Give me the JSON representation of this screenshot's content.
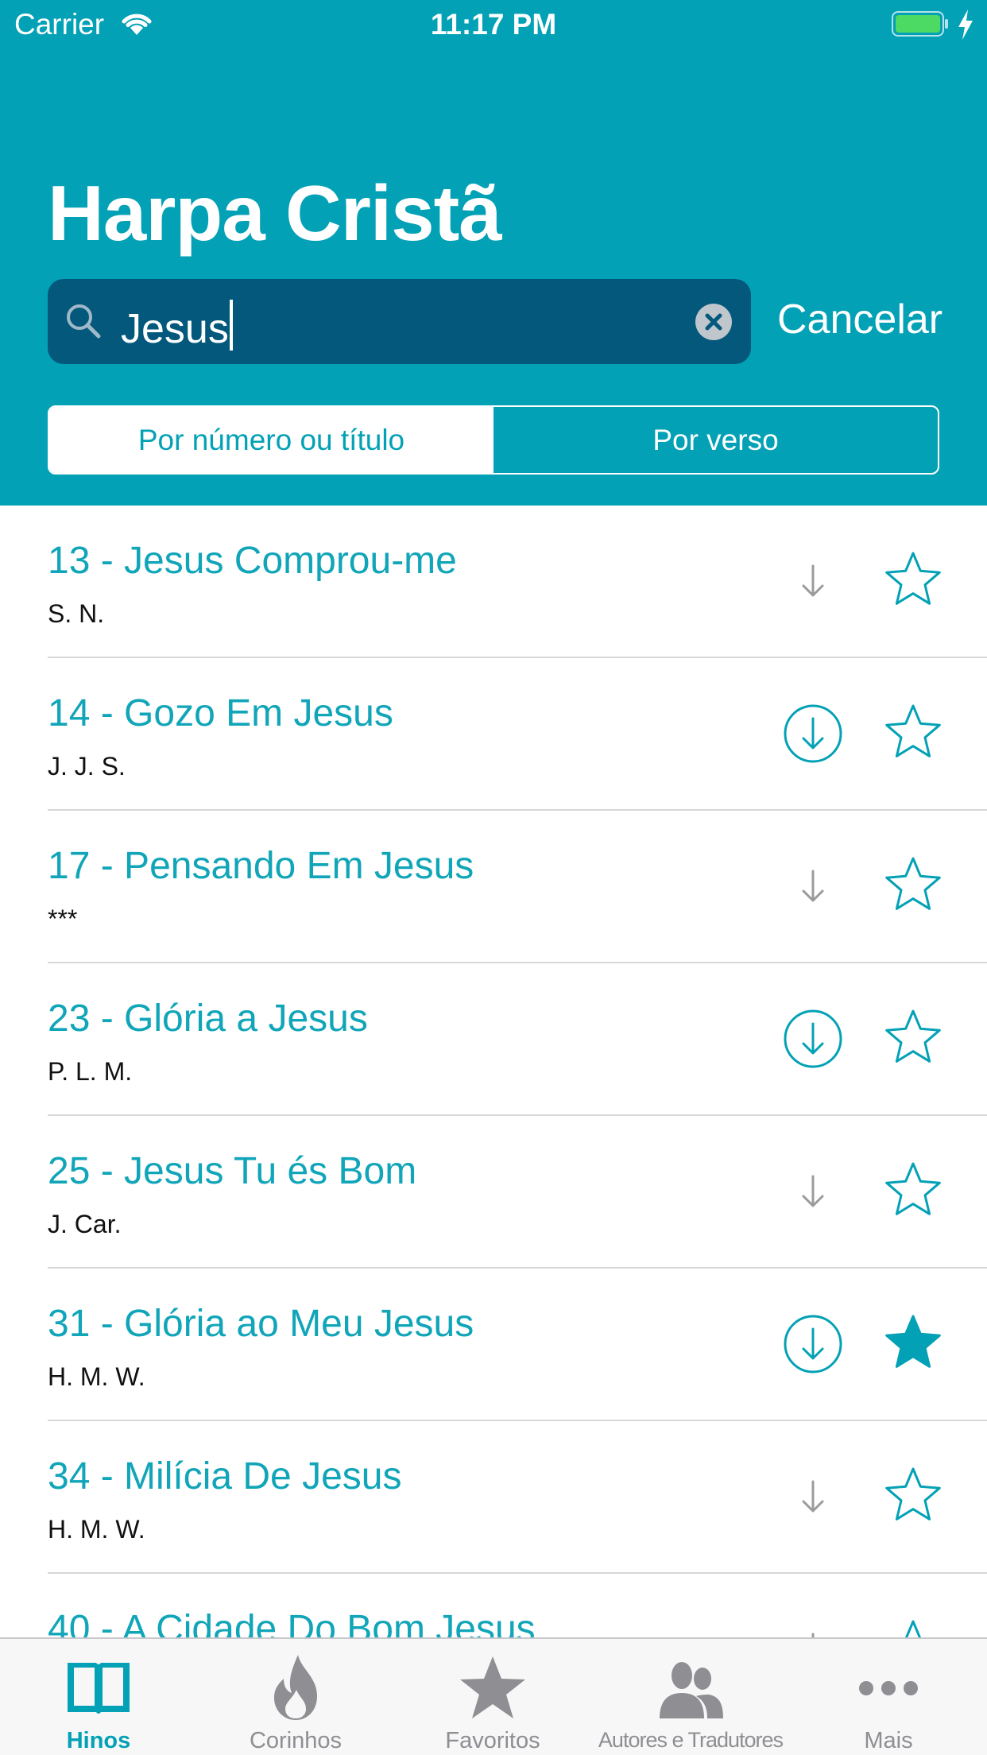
{
  "status_bar": {
    "carrier": "Carrier",
    "time": "11:17 PM"
  },
  "header": {
    "title": "Harpa Cristã"
  },
  "search": {
    "query": "Jesus",
    "cancel_label": "Cancelar"
  },
  "segments": [
    {
      "label": "Por número ou título",
      "selected": true
    },
    {
      "label": "Por verso",
      "selected": false
    }
  ],
  "colors": {
    "accent": "#03A1B6",
    "search_field": "#03587C",
    "favorite": "#03A1B6"
  },
  "hymns": [
    {
      "title": "13 - Jesus Comprou-me",
      "author": "S. N.",
      "downloaded": false,
      "favorite": false
    },
    {
      "title": "14 - Gozo Em Jesus",
      "author": "J. J. S.",
      "downloaded": true,
      "favorite": false
    },
    {
      "title": "17 - Pensando Em Jesus",
      "author": "***",
      "downloaded": false,
      "favorite": false
    },
    {
      "title": "23 - Glória a Jesus",
      "author": "P. L. M.",
      "downloaded": true,
      "favorite": false
    },
    {
      "title": "25 - Jesus Tu és Bom",
      "author": "J. Car.",
      "downloaded": false,
      "favorite": false
    },
    {
      "title": "31 - Glória ao Meu Jesus",
      "author": "H. M. W.",
      "downloaded": true,
      "favorite": true
    },
    {
      "title": "34 - Milícia De Jesus",
      "author": "H. M. W.",
      "downloaded": false,
      "favorite": false
    },
    {
      "title": "40 - A Cidade Do Bom Jesus",
      "author": "",
      "downloaded": false,
      "favorite": false
    }
  ],
  "tabs": [
    {
      "label": "Hinos",
      "icon": "book-icon",
      "active": true
    },
    {
      "label": "Corinhos",
      "icon": "flame-icon",
      "active": false
    },
    {
      "label": "Favoritos",
      "icon": "star-icon",
      "active": false
    },
    {
      "label": "Autores e Tradutores",
      "icon": "people-icon",
      "active": false
    },
    {
      "label": "Mais",
      "icon": "more-icon",
      "active": false
    }
  ]
}
